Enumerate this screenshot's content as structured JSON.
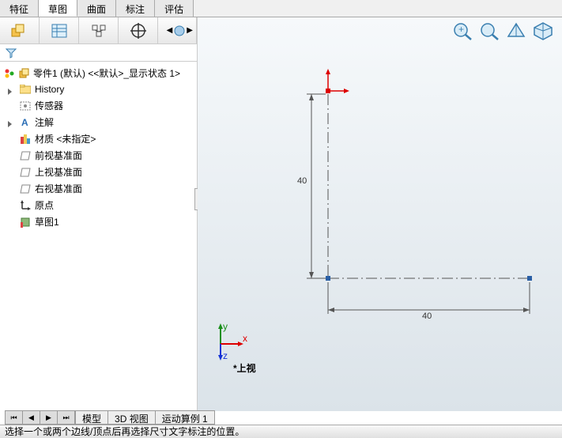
{
  "tabs": {
    "t0": "特征",
    "t1": "草图",
    "t2": "曲面",
    "t3": "标注",
    "t4": "评估"
  },
  "tree": {
    "root": "零件1 (默认) <<默认>_显示状态 1>",
    "items": {
      "history": "History",
      "sensors": "传感器",
      "annotations": "注解",
      "material": "材质 <未指定>",
      "front": "前视基准面",
      "top": "上视基准面",
      "right": "右视基准面",
      "origin": "原点",
      "sketch1": "草图1"
    }
  },
  "dimensions": {
    "vert": "40",
    "horiz": "40"
  },
  "axes": {
    "x": "x",
    "y": "y",
    "z": "z"
  },
  "view_label": "*上视",
  "bottom_tabs": {
    "model": "模型",
    "view3d": "3D 视图",
    "motion": "运动算例 1"
  },
  "status": "选择一个或两个边线/顶点后再选择尺寸文字标注的位置。"
}
